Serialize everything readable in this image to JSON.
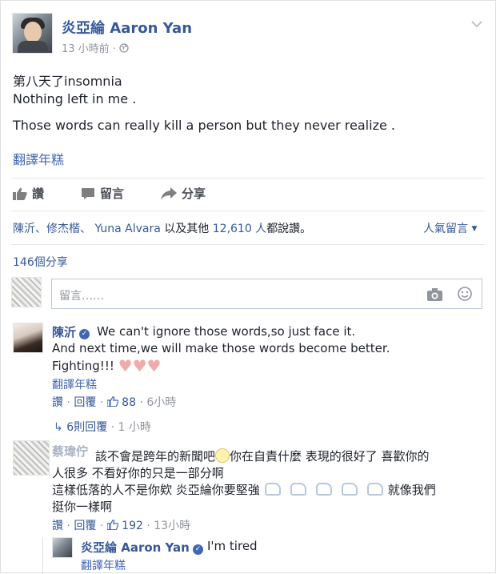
{
  "post": {
    "author": "炎亞綸 Aaron Yan",
    "time": "13 小時前",
    "privacy_sep": "·",
    "lines": [
      "第八天了insomnia",
      "Nothing left in me .",
      "Those words can really kill a person but they never realize ."
    ],
    "translate": "翻譯年糕"
  },
  "actions": {
    "like": "讚",
    "comment": "留言",
    "share": "分享"
  },
  "likes": {
    "names": "陳沂、修杰楷、 Yuna Alvara",
    "middle": "以及其他",
    "count": "12,610 人",
    "tail": "都說讚。",
    "sort": "人氣留言"
  },
  "shares": "146個分享",
  "composer": {
    "placeholder": "留言……"
  },
  "comments": [
    {
      "name": "陳沂",
      "text_lines": [
        "We can't ignore those words,so just face it.",
        "And next time,we will make those words become better.",
        "Fighting!!!"
      ],
      "translate": "翻譯年糕",
      "like": "讚",
      "reply": "回覆",
      "likes": "88",
      "time": "6小時",
      "replies_link": "6則回覆",
      "replies_time": "1 小時"
    },
    {
      "name": "蔡瑋佇",
      "line1a": "該不會是跨年的新聞吧",
      "line1b": "你在自責什麼 表現的很好了 喜歡你的",
      "line2": "人很多 不看好你的只是一部分啊",
      "line3a": "這樣低落的人不是你欸 炎亞綸你要堅強",
      "line3b": "就像我們",
      "line4": "挺你一樣啊",
      "like": "讚",
      "reply": "回覆",
      "likes": "192",
      "time": "13小時"
    }
  ],
  "nested_reply": {
    "name": "炎亞綸 Aaron Yan",
    "text": "I'm tired",
    "translate": "翻譯年糕"
  },
  "separator_dot": "·",
  "colors": {
    "link": "#365899",
    "meta": "#90949c",
    "text": "#1d2129"
  }
}
